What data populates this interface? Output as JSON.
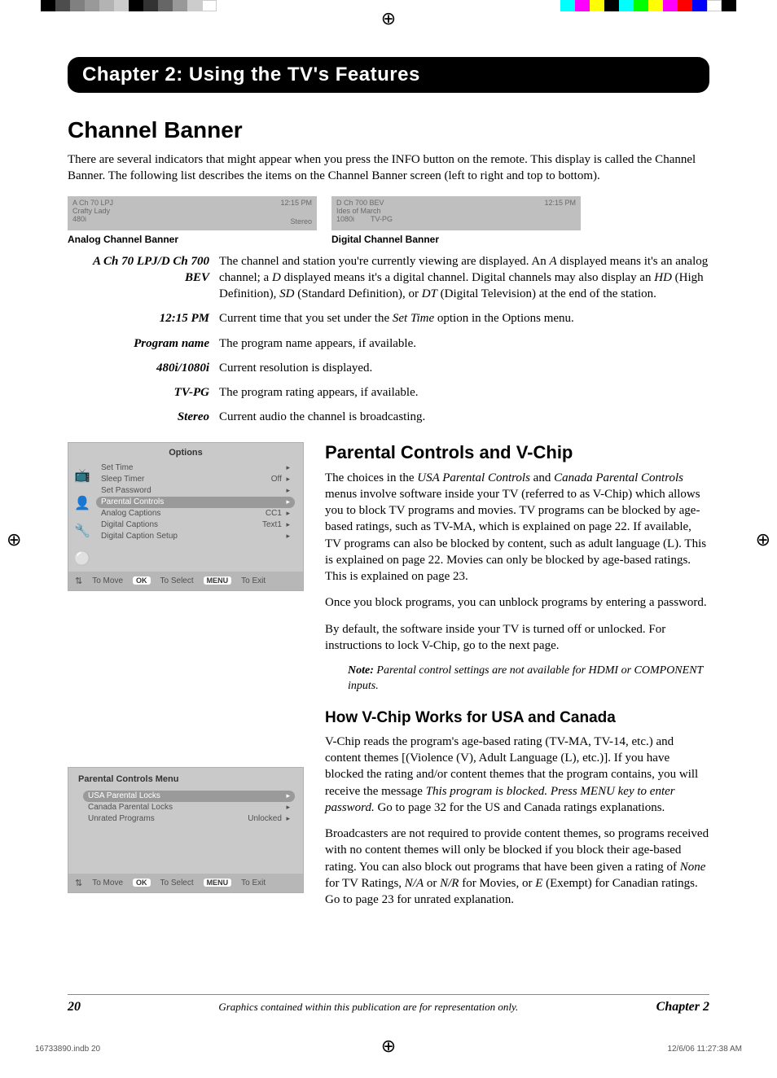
{
  "chapter_bar": "Chapter 2: Using the TV's Features",
  "section1": {
    "heading": "Channel Banner",
    "intro": "There are several indicators that might appear when you press the INFO button on the remote. This display is called the Channel Banner. The following list describes the items on the Channel Banner screen (left to right and top to bottom)."
  },
  "analog_banner": {
    "line1": "A Ch 70 LPJ",
    "time": "12:15 PM",
    "line2": "Crafty Lady",
    "line3": "480i",
    "audio": "Stereo",
    "caption": "Analog Channel Banner"
  },
  "digital_banner": {
    "line1": "D Ch 700 BEV",
    "time": "12:15 PM",
    "line2": "Ides of March",
    "line3a": "1080i",
    "line3b": "TV-PG",
    "caption": "Digital Channel Banner"
  },
  "defs": [
    {
      "term": "A Ch 70 LPJ/D Ch 700 BEV",
      "body_pre": "The channel and station you're currently viewing are displayed. An ",
      "i1": "A",
      "body_mid1": " displayed means it's an analog channel; a ",
      "i2": "D",
      "body_mid2": " displayed means it's a digital channel. Digital channels may also display an ",
      "i3": "HD",
      "body_mid3": " (High Definition), ",
      "i4": "SD",
      "body_mid4": " (Standard Definition), or ",
      "i5": "DT",
      "body_post": " (Digital Television) at the end of the station."
    },
    {
      "term": "12:15 PM",
      "body_pre": "Current time that you set under the ",
      "i1": "Set Time",
      "body_post": " option in the Options menu."
    },
    {
      "term": "Program name",
      "body": "The program name appears, if available."
    },
    {
      "term": "480i/1080i",
      "body": "Current resolution is displayed."
    },
    {
      "term": "TV-PG",
      "body": "The program rating appears, if available."
    },
    {
      "term": "Stereo",
      "body": "Current audio the channel is broadcasting."
    }
  ],
  "options_menu": {
    "title": "Options",
    "items": [
      {
        "label": "Set Time",
        "value": ""
      },
      {
        "label": "Sleep Timer",
        "value": "Off"
      },
      {
        "label": "Set Password",
        "value": ""
      },
      {
        "label": "Parental Controls",
        "value": "",
        "hl": true
      },
      {
        "label": "Analog Captions",
        "value": "CC1"
      },
      {
        "label": "Digital Captions",
        "value": "Text1"
      },
      {
        "label": "Digital Caption Setup",
        "value": ""
      }
    ],
    "footer": {
      "move": "To Move",
      "ok": "OK",
      "select": "To Select",
      "menu": "MENU",
      "exit": "To Exit"
    }
  },
  "pc_menu": {
    "title": "Parental Controls Menu",
    "items": [
      {
        "label": "USA Parental Locks",
        "value": "",
        "hl": true
      },
      {
        "label": "Canada Parental Locks",
        "value": ""
      },
      {
        "label": "Unrated Programs",
        "value": "Unlocked"
      }
    ],
    "footer": {
      "move": "To Move",
      "ok": "OK",
      "select": "To Select",
      "menu": "MENU",
      "exit": "To Exit"
    }
  },
  "section2": {
    "heading": "Parental Controls and V-Chip",
    "p1_pre": "The choices in the ",
    "p1_i1": "USA Parental Controls",
    "p1_mid": " and ",
    "p1_i2": "Canada Parental Controls",
    "p1_post": " menus involve software inside your TV (referred to as V-Chip) which allows you to block TV programs and movies. TV programs can be blocked by age-based ratings, such as TV-MA, which is explained on page 22. If available, TV programs can also be blocked by content, such as adult language (L). This is explained on page 22. Movies can only be blocked by age-based ratings. This is explained on page 23.",
    "p2": "Once you block programs, you can unblock programs by entering a password.",
    "p3": "By default, the software inside your TV is turned off or unlocked. For instructions to lock V-Chip, go to the next page.",
    "note_label": "Note:",
    "note_body": " Parental control settings are not available for HDMI or COMPONENT inputs."
  },
  "section3": {
    "heading": "How V-Chip Works for USA and Canada",
    "p1_pre": "V-Chip reads the program's age-based rating (TV-MA, TV-14, etc.) and content themes [(Violence (V), Adult Language (L), etc.)]. If you have blocked the rating and/or content themes that the program contains, you will receive the message ",
    "p1_i1": "This program is blocked. Press MENU key to enter password.",
    "p1_post": " Go to page 32 for the US and Canada ratings explanations.",
    "p2_pre": "Broadcasters are not required to provide content themes, so programs received with no content themes will only be blocked if you block their age-based rating. You can also block out programs that have been given a rating of ",
    "p2_i1": "None",
    "p2_mid1": " for TV Ratings, ",
    "p2_i2": "N/A",
    "p2_mid2": " or ",
    "p2_i3": "N/R",
    "p2_mid3": " for Movies, or ",
    "p2_i4": "E",
    "p2_post": " (Exempt) for Canadian ratings. Go to page 23 for unrated explanation."
  },
  "footer": {
    "page_num": "20",
    "mid": "Graphics contained within this publication are for representation only.",
    "chapter": "Chapter 2"
  },
  "print_line": {
    "file": "16733890.indb   20",
    "stamp": "12/6/06   11:27:38 AM"
  }
}
